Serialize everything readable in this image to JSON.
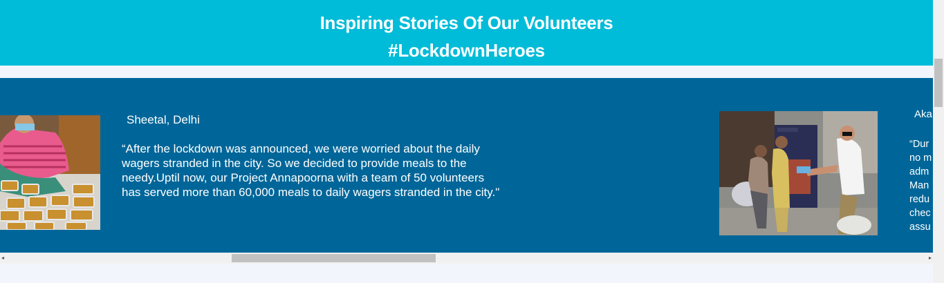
{
  "header": {
    "title": "Inspiring Stories Of Our Volunteers",
    "hashtag": "#LockdownHeroes",
    "background": "#00bcd8"
  },
  "carousel": {
    "background": "#006699",
    "stories": [
      {
        "name": "Sheetal, Delhi",
        "quote": "“After the lockdown was announced, we were worried about the daily wagers stranded in the city. So we decided to provide meals to the needy.Uptil now, our Project Annapoorna with a team of 50 volunteers has served more than 60,000 meals to daily wagers stranded in the city.\"",
        "quote_lines": [
          "“After the lockdown was announced, we were worried about the daily",
          "wagers stranded in the city. So we decided to provide meals to the",
          "needy.Uptil now, our Project Annapoorna with a team of 50 volunteers",
          "has served more than 60,000 meals to daily wagers stranded in the city.\""
        ],
        "photo_icon": "volunteer-packing-meals-photo"
      },
      {
        "name": "Aka",
        "quote_lines": [
          "“Dur",
          "no m",
          "adm",
          "Man",
          "redu",
          "chec",
          "assu"
        ],
        "photo_icon": "volunteers-distributing-masks-photo"
      }
    ]
  },
  "scrollbars": {
    "horizontal": {
      "left_arrow": "◂",
      "right_arrow": "▸",
      "position": 0.25
    },
    "vertical": {
      "position": 0.0
    }
  }
}
